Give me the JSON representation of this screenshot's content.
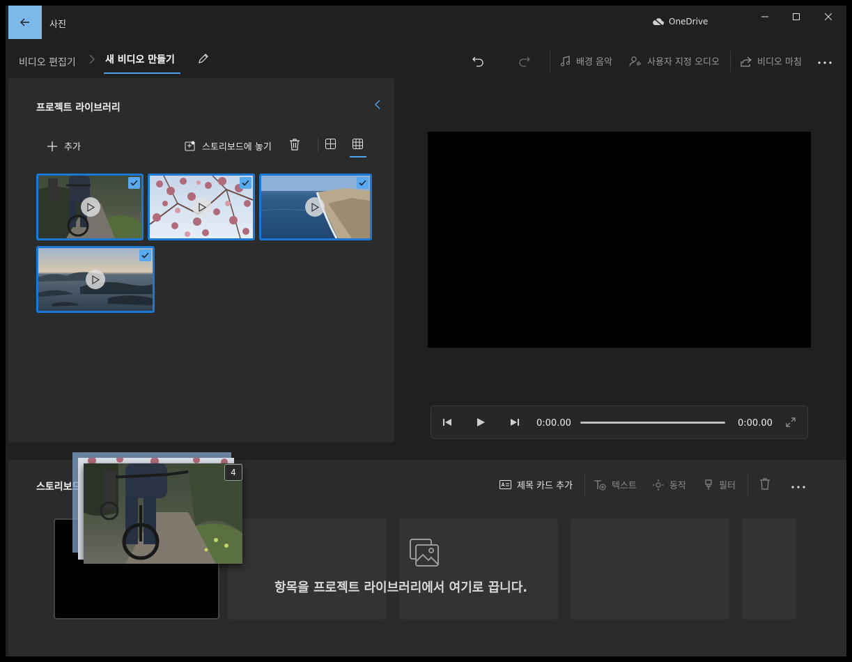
{
  "app": {
    "title": "사진",
    "onedrive_label": "OneDrive"
  },
  "breadcrumb": {
    "root": "비디오 편집기",
    "current": "새 비디오 만들기"
  },
  "toolbar": {
    "background_music": "배경 음악",
    "custom_audio": "사용자 지정 오디오",
    "finish_video": "비디오 마침"
  },
  "library": {
    "title": "프로젝트 라이브러리",
    "add_label": "추가",
    "place_in_storyboard_label": "스토리보드에 놓기",
    "items": [
      {
        "scene": "cyclist",
        "selected": true
      },
      {
        "scene": "blossoms",
        "selected": true
      },
      {
        "scene": "coast",
        "selected": true
      },
      {
        "scene": "islands",
        "selected": true
      }
    ]
  },
  "player": {
    "current_time": "0:00.00",
    "total_time": "0:00.00",
    "progress": 0
  },
  "storyboard": {
    "title": "스토리보드",
    "add_title_card": "제목 카드 추가",
    "text": "텍스트",
    "motion": "동작",
    "filter": "필터",
    "drop_hint": "항목을 프로젝트 라이브러리에서 여기로 끕니다.",
    "drag_count": "4"
  },
  "colors": {
    "accent": "#4ca3ec",
    "selection": "#1a78d6",
    "back_button": "#7cb8e8"
  }
}
